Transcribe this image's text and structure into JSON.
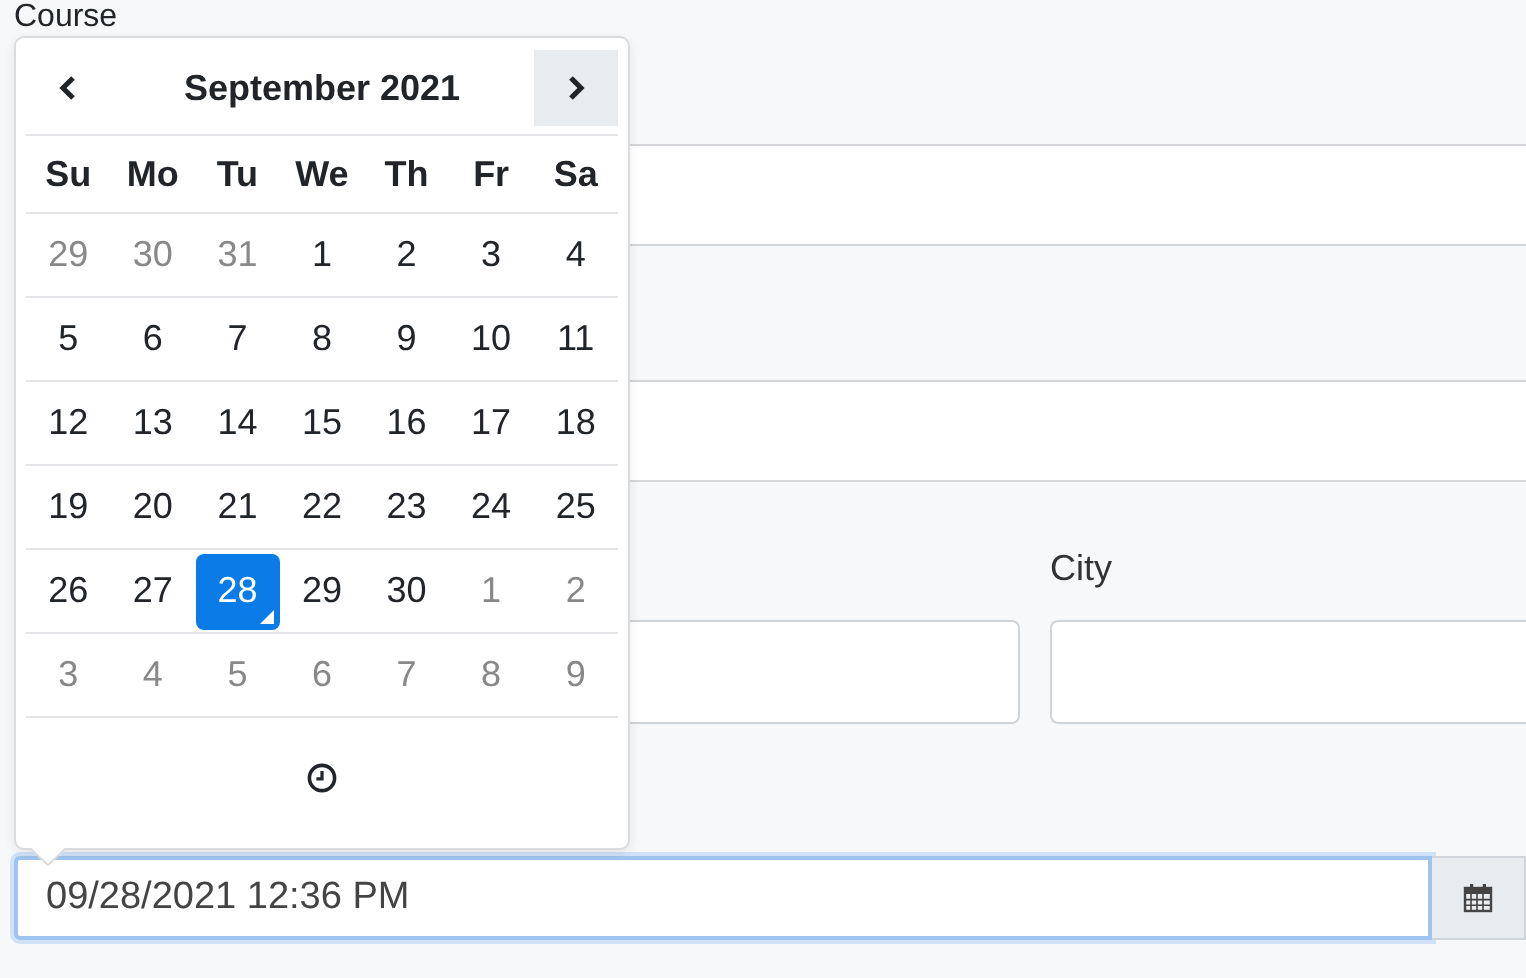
{
  "form": {
    "course_label": "Course",
    "city_label": "City",
    "datetime_value": "09/28/2021 12:36 PM"
  },
  "picker": {
    "title": "September 2021",
    "weekdays": [
      "Su",
      "Mo",
      "Tu",
      "We",
      "Th",
      "Fr",
      "Sa"
    ],
    "weeks": [
      [
        {
          "day": "29",
          "muted": true,
          "selected": false
        },
        {
          "day": "30",
          "muted": true,
          "selected": false
        },
        {
          "day": "31",
          "muted": true,
          "selected": false
        },
        {
          "day": "1",
          "muted": false,
          "selected": false
        },
        {
          "day": "2",
          "muted": false,
          "selected": false
        },
        {
          "day": "3",
          "muted": false,
          "selected": false
        },
        {
          "day": "4",
          "muted": false,
          "selected": false
        }
      ],
      [
        {
          "day": "5",
          "muted": false,
          "selected": false
        },
        {
          "day": "6",
          "muted": false,
          "selected": false
        },
        {
          "day": "7",
          "muted": false,
          "selected": false
        },
        {
          "day": "8",
          "muted": false,
          "selected": false
        },
        {
          "day": "9",
          "muted": false,
          "selected": false
        },
        {
          "day": "10",
          "muted": false,
          "selected": false
        },
        {
          "day": "11",
          "muted": false,
          "selected": false
        }
      ],
      [
        {
          "day": "12",
          "muted": false,
          "selected": false
        },
        {
          "day": "13",
          "muted": false,
          "selected": false
        },
        {
          "day": "14",
          "muted": false,
          "selected": false
        },
        {
          "day": "15",
          "muted": false,
          "selected": false
        },
        {
          "day": "16",
          "muted": false,
          "selected": false
        },
        {
          "day": "17",
          "muted": false,
          "selected": false
        },
        {
          "day": "18",
          "muted": false,
          "selected": false
        }
      ],
      [
        {
          "day": "19",
          "muted": false,
          "selected": false
        },
        {
          "day": "20",
          "muted": false,
          "selected": false
        },
        {
          "day": "21",
          "muted": false,
          "selected": false
        },
        {
          "day": "22",
          "muted": false,
          "selected": false
        },
        {
          "day": "23",
          "muted": false,
          "selected": false
        },
        {
          "day": "24",
          "muted": false,
          "selected": false
        },
        {
          "day": "25",
          "muted": false,
          "selected": false
        }
      ],
      [
        {
          "day": "26",
          "muted": false,
          "selected": false
        },
        {
          "day": "27",
          "muted": false,
          "selected": false
        },
        {
          "day": "28",
          "muted": false,
          "selected": true
        },
        {
          "day": "29",
          "muted": false,
          "selected": false
        },
        {
          "day": "30",
          "muted": false,
          "selected": false
        },
        {
          "day": "1",
          "muted": true,
          "selected": false
        },
        {
          "day": "2",
          "muted": true,
          "selected": false
        }
      ],
      [
        {
          "day": "3",
          "muted": true,
          "selected": false
        },
        {
          "day": "4",
          "muted": true,
          "selected": false
        },
        {
          "day": "5",
          "muted": true,
          "selected": false
        },
        {
          "day": "6",
          "muted": true,
          "selected": false
        },
        {
          "day": "7",
          "muted": true,
          "selected": false
        },
        {
          "day": "8",
          "muted": true,
          "selected": false
        },
        {
          "day": "9",
          "muted": true,
          "selected": false
        }
      ]
    ]
  }
}
